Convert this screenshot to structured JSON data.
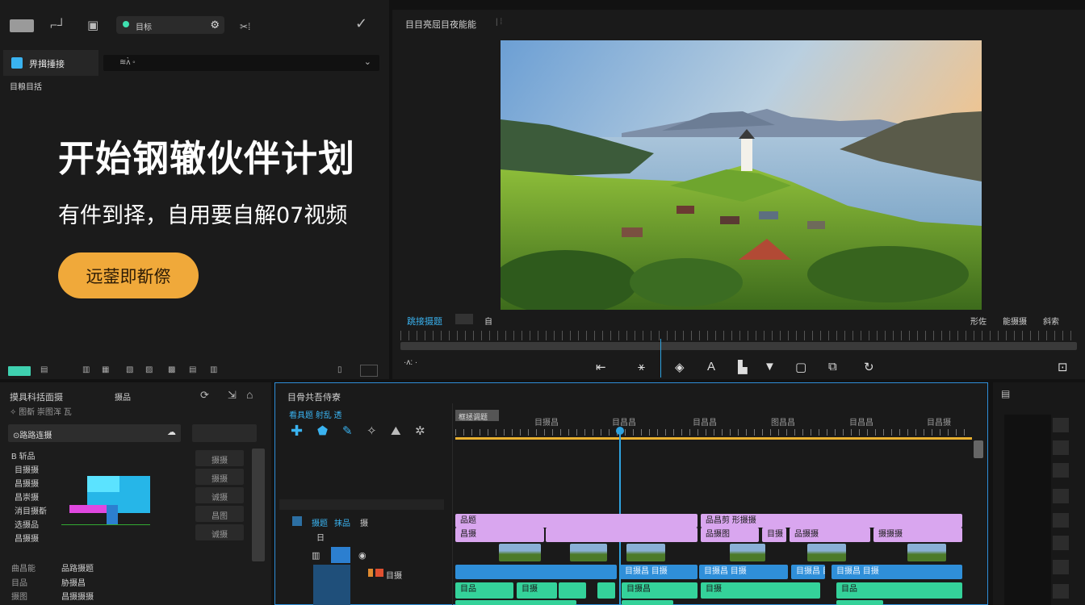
{
  "top_bar": {
    "search_label": "目标",
    "preview_title": "目目亮屈目夜能能"
  },
  "left_panel": {
    "tab_label": "畀揖捶接",
    "field_text": "≋ʌ̀ ◦",
    "sub_label": "目粮目括"
  },
  "hero": {
    "title": "开始钢辙伙伴计划",
    "subtitle": "有件到择，自用要自解07视频",
    "cta_label": "远蓥即斱傺"
  },
  "preview": {
    "controls_left": "跳接摄题",
    "controls_mid": "自",
    "controls_right": [
      "形佐",
      "能摄摄",
      "斜索"
    ],
    "timecode": "·ʌ: ·"
  },
  "bottom_left": {
    "title": "摸具科括面摄",
    "tab": "摄品",
    "sub": "✧ 图斱 崇图浑 瓦",
    "dropdown": "⊙路路连摄",
    "items": [
      "B 斩品",
      "目摄摄",
      "昌摄摄",
      "昌崇摄",
      "消目摄斱",
      "选摄品",
      "昌摄摄"
    ],
    "bottom_items": [
      "曲昌能",
      "目品",
      "摄图"
    ],
    "mid_items": [
      "品路摄题",
      "胁摄昌",
      "昌摄摄摄"
    ],
    "buttons": [
      "摄摄",
      "摄摄",
      "诚摄",
      "昌图",
      "诚摄"
    ]
  },
  "timeline": {
    "title": "目骨共吾侍寮",
    "tools_label": "看具题 射乱 透",
    "ruler_label": "框拯调题",
    "ruler_marks": [
      "目摄昌",
      "目昌昌",
      "目昌昌",
      "图昌昌",
      "目昌昌",
      "目昌摄"
    ],
    "track_labels": [
      "摄题",
      "抹品",
      "摄",
      "日"
    ],
    "clip_labels": [
      "品题",
      "品昌剪 形摄摄",
      "昌摄",
      "品摄图",
      "目摄",
      "品摄摄",
      "摄摄摄"
    ],
    "blue_clips": [
      "目摄昌 目摄",
      "目摄昌 目摄",
      "目摄昌 目摄",
      "目摄昌 目摄"
    ],
    "green_clips": [
      "目品",
      "目摄",
      "目摄昌",
      "目摄",
      "目品"
    ],
    "track_right": "目摄"
  },
  "colors": {
    "accent": "#2fa3e0",
    "cta": "#f0a93a",
    "purple_clip": "#d9a6ef",
    "green_clip": "#34d29a",
    "blue_clip": "#2f8fd9"
  }
}
